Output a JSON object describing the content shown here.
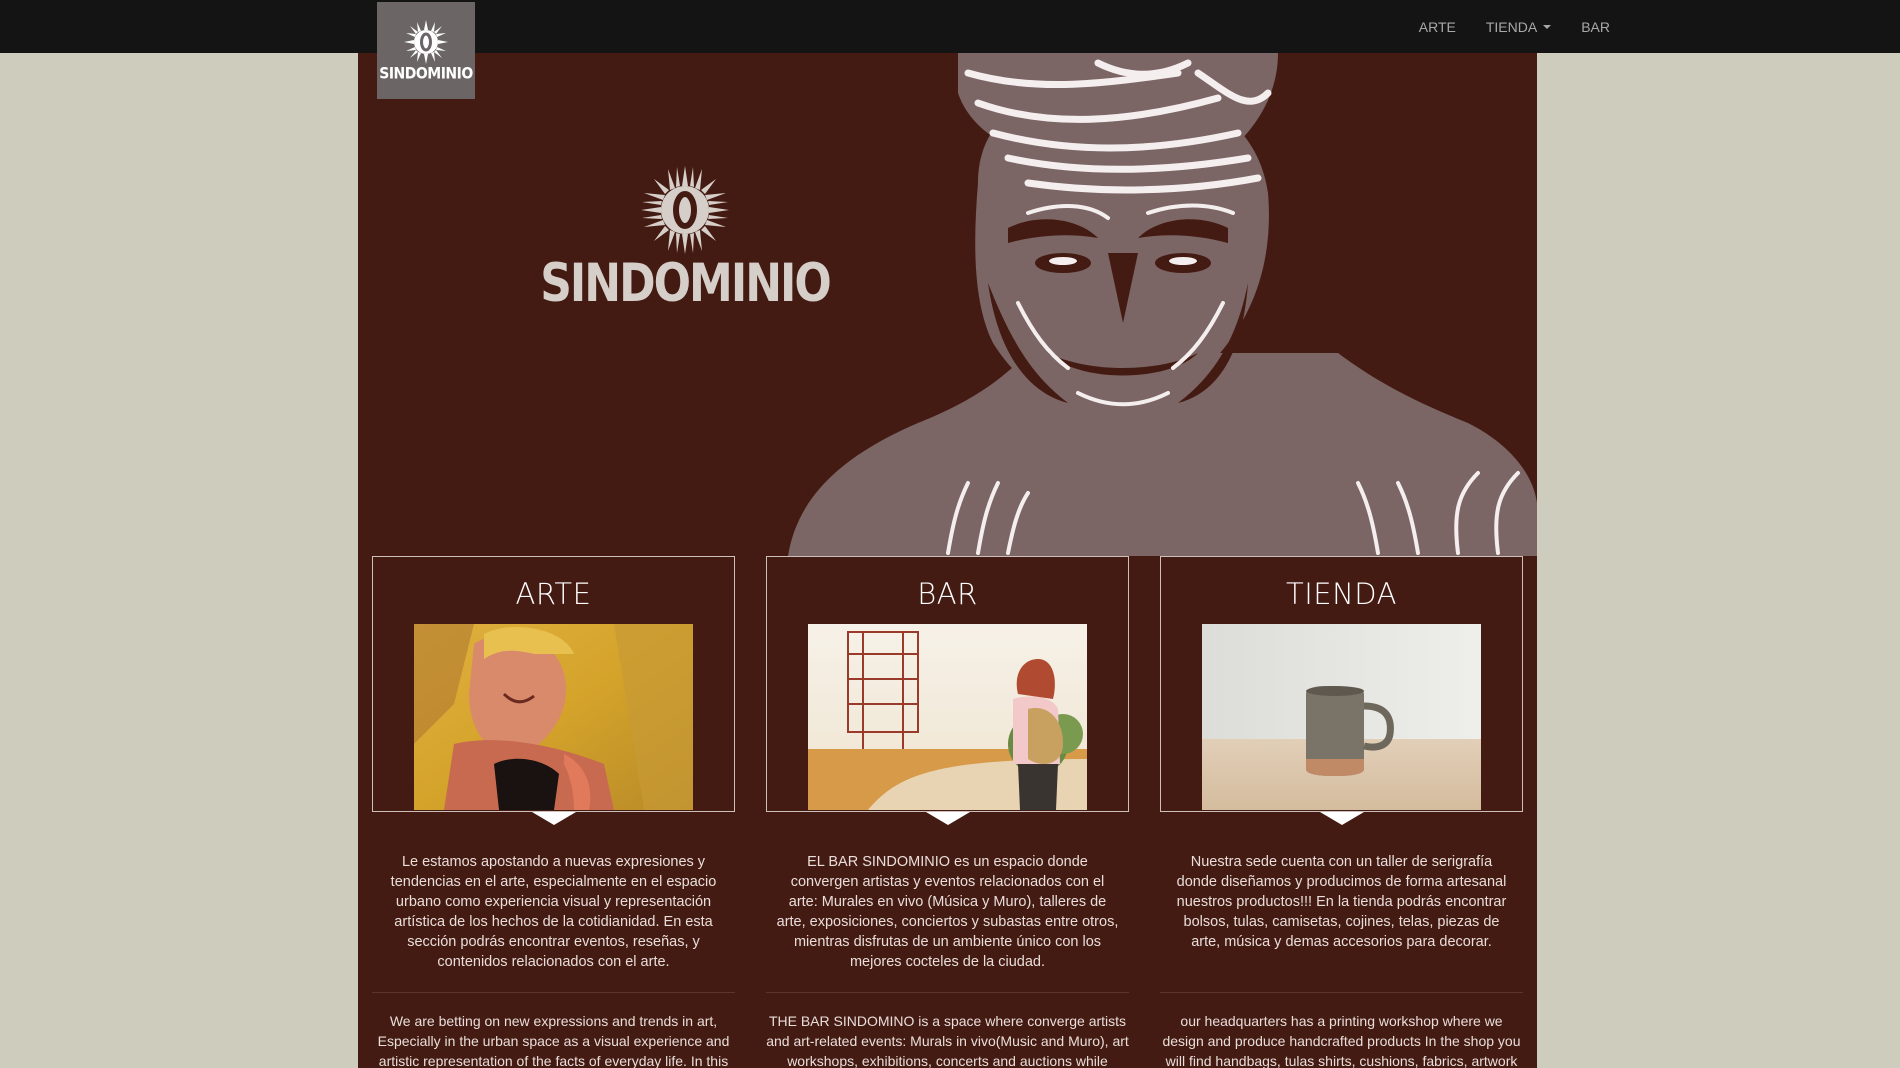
{
  "brand": {
    "name": "SINDOMINIO"
  },
  "nav": {
    "items": [
      {
        "label": "ARTE"
      },
      {
        "label": "TIENDA"
      },
      {
        "label": "BAR"
      }
    ]
  },
  "hero": {
    "logo_text": "SINDOMINIO"
  },
  "colors": {
    "page_bg": "#cdccbd",
    "navbar": "#141414",
    "content_bg": "#441b12",
    "logo_box": "#6b6566",
    "illustration": "#7c6565"
  },
  "cards": [
    {
      "title": "ARTE",
      "text_es": "Le estamos apostando a nuevas expresiones y tendencias en el arte, especialmente en el espacio urbano como experiencia visual y representación artística de los hechos de la cotidianidad. En esta sección podrás encontrar eventos, reseñas, y contenidos relacionados con el arte.",
      "text_en": "We are betting on new expressions and trends in art, Especially in the urban space as a visual experience and artistic representation of the facts of everyday life. In this section you"
    },
    {
      "title": "BAR",
      "text_es": "EL BAR SINDOMINIO es un espacio donde convergen artistas y eventos relacionados con el arte: Murales en vivo (Música y Muro), talleres de arte, exposiciones, conciertos y subastas entre otros, mientras disfrutas de un ambiente único con los mejores cocteles de la ciudad.",
      "text_en": "THE BAR SINDOMINO is a space where converge artists and art-related events: Murals in vivo(Music and Muro), art workshops, exhibitions, concerts and auctions while"
    },
    {
      "title": "TIENDA",
      "text_es": "Nuestra sede cuenta con un taller de serigrafía donde diseñamos y producimos de forma artesanal nuestros productos!!! En la tienda podrás encontrar bolsos, tulas, camisetas, cojines, telas, piezas de arte, música y demas accesorios para decorar.",
      "text_en": "our headquarters has a printing workshop where we design and produce handcrafted products In the shop you will find handbags, tulas shirts, cushions, fabrics, artwork"
    }
  ]
}
